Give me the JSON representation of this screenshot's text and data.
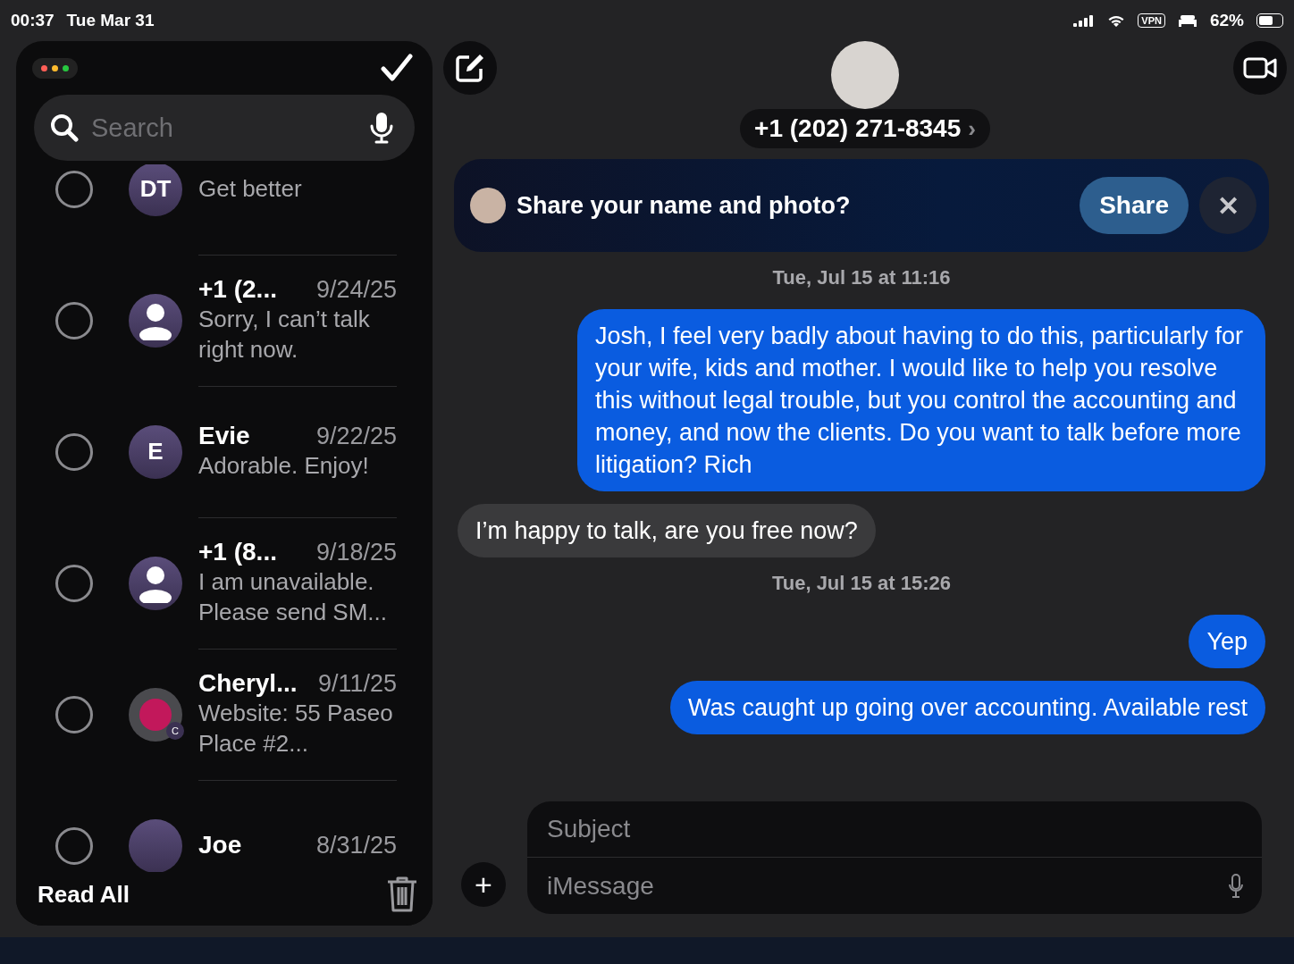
{
  "status_bar": {
    "time": "00:37",
    "date": "Tue Mar 31",
    "vpn": "VPN",
    "battery": "62%"
  },
  "sidebar": {
    "search": {
      "placeholder": "Search"
    },
    "conversations": [
      {
        "avatar": {
          "kind": "initials",
          "initials": "DT"
        },
        "preview": "Get better",
        "selected": false
      },
      {
        "avatar": {
          "kind": "person"
        },
        "name": "+1 (2...",
        "date": "9/24/25",
        "preview": "Sorry, I can’t talk right now.",
        "selected": false
      },
      {
        "avatar": {
          "kind": "initials",
          "initials": "E"
        },
        "name": "Evie",
        "date": "9/22/25",
        "preview": "Adorable. Enjoy!",
        "selected": false
      },
      {
        "avatar": {
          "kind": "person"
        },
        "name": "+1 (8...",
        "date": "9/18/25",
        "preview": "I am unavailable. Please send SM...",
        "selected": false
      },
      {
        "avatar": {
          "kind": "photo",
          "badge": "C"
        },
        "name": "Cheryl...",
        "date": "9/11/25",
        "preview": "Website: 55 Paseo Place #2...",
        "selected": false
      },
      {
        "avatar": {
          "kind": "initials"
        },
        "name": "Joe",
        "date": "8/31/25",
        "selected": false
      }
    ],
    "read_all": "Read All"
  },
  "chat": {
    "contact": "+1 (202) 271-8345",
    "contact_chevron": "›",
    "share_banner": {
      "text": "Share your name and photo?",
      "button": "Share",
      "close": "✕"
    },
    "messages": [
      {
        "kind": "time",
        "text": "Tue, Jul 15 at 11:16"
      },
      {
        "kind": "out",
        "text": "Josh,  I feel very badly about having to do this, particularly for your wife, kids and mother.  I would like to help you resolve this without legal trouble, but you control the accounting and money, and now the clients. Do you want to talk before more litigation?  Rich"
      },
      {
        "kind": "in",
        "text": "I’m happy to talk, are you free now?"
      },
      {
        "kind": "time",
        "text": "Tue, Jul 15 at 15:26"
      },
      {
        "kind": "out",
        "text": "Yep"
      },
      {
        "kind": "out",
        "text": "Was caught up going over accounting. Available rest"
      }
    ],
    "composer": {
      "subject_placeholder": "Subject",
      "message_placeholder": "iMessage",
      "plus": "+"
    }
  }
}
